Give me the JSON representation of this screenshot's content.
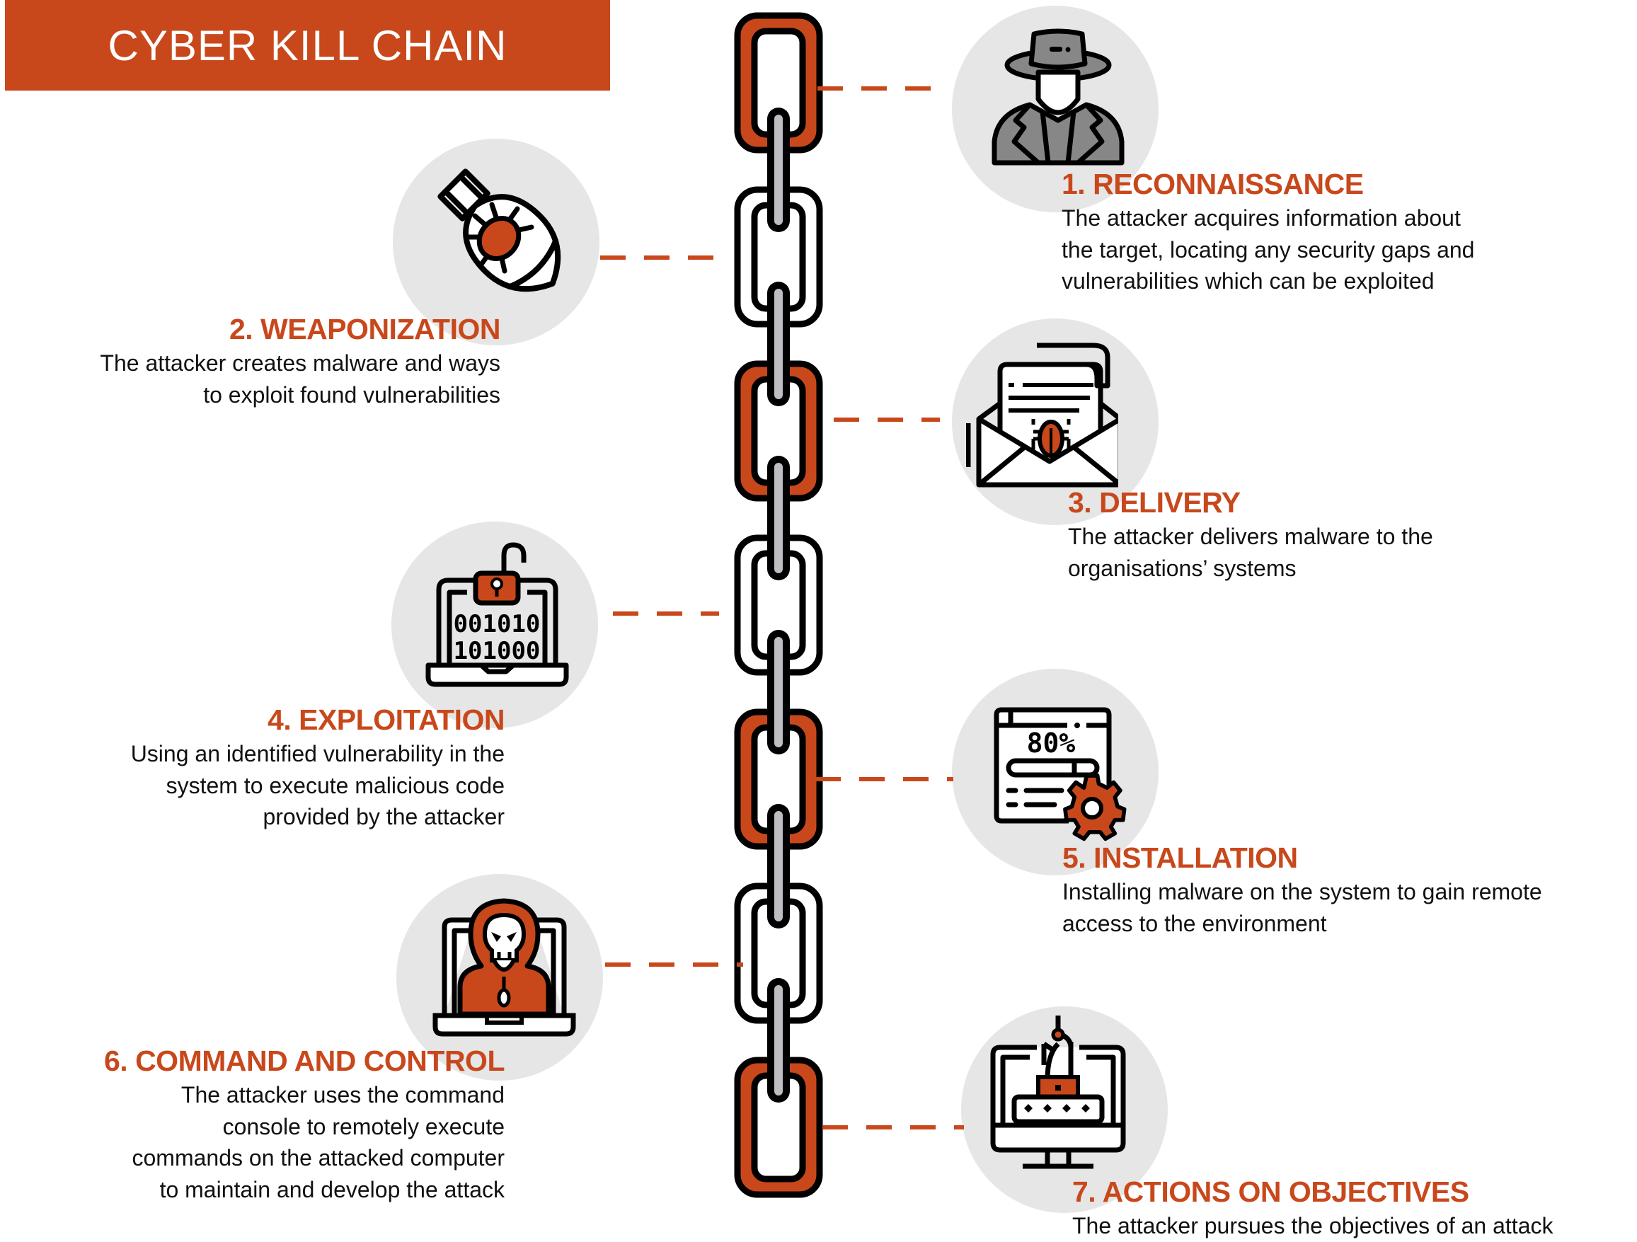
{
  "title": "CYBER KILL CHAIN",
  "colors": {
    "accent": "#c8481c",
    "circle": "#e6e6e6",
    "chain_rod": "#bdbdc2",
    "text": "#111111"
  },
  "chain": {
    "links": [
      "accent",
      "white",
      "accent",
      "white",
      "accent",
      "white",
      "accent"
    ]
  },
  "steps": [
    {
      "heading": "1. RECONNAISSANCE",
      "icon": "spy-icon",
      "side": "right",
      "lines": [
        "The attacker acquires information about",
        "the target, locating any security gaps and",
        "vulnerabilities which can be exploited"
      ]
    },
    {
      "heading": "2. WEAPONIZATION",
      "icon": "bomb-bug-icon",
      "side": "left",
      "lines": [
        "The attacker creates malware and ways",
        "to exploit found vulnerabilities"
      ]
    },
    {
      "heading": "3. DELIVERY",
      "icon": "email-bug-icon",
      "side": "right",
      "lines": [
        "The attacker delivers malware to the",
        "organisations’ systems"
      ]
    },
    {
      "heading": "4. EXPLOITATION",
      "icon": "laptop-unlock-icon",
      "side": "left",
      "lines": [
        "Using an identified vulnerability in the",
        "system to execute malicious code",
        "provided by the attacker"
      ],
      "icon_text": [
        "001010",
        "101000"
      ]
    },
    {
      "heading": "5. INSTALLATION",
      "icon": "install-progress-icon",
      "side": "right",
      "lines": [
        "Installing malware on the system to gain remote",
        "access to the environment"
      ],
      "icon_text": [
        "80%"
      ]
    },
    {
      "heading": "6. COMMAND AND CONTROL",
      "icon": "hacker-laptop-icon",
      "side": "left",
      "lines": [
        "The attacker uses the command",
        "console to remotely execute",
        "commands on the attacked computer",
        "to maintain and develop the attack"
      ]
    },
    {
      "heading": "7. ACTIONS ON OBJECTIVES",
      "icon": "phishing-password-icon",
      "side": "right",
      "lines": [
        "The attacker pursues the objectives of an attack"
      ]
    }
  ]
}
